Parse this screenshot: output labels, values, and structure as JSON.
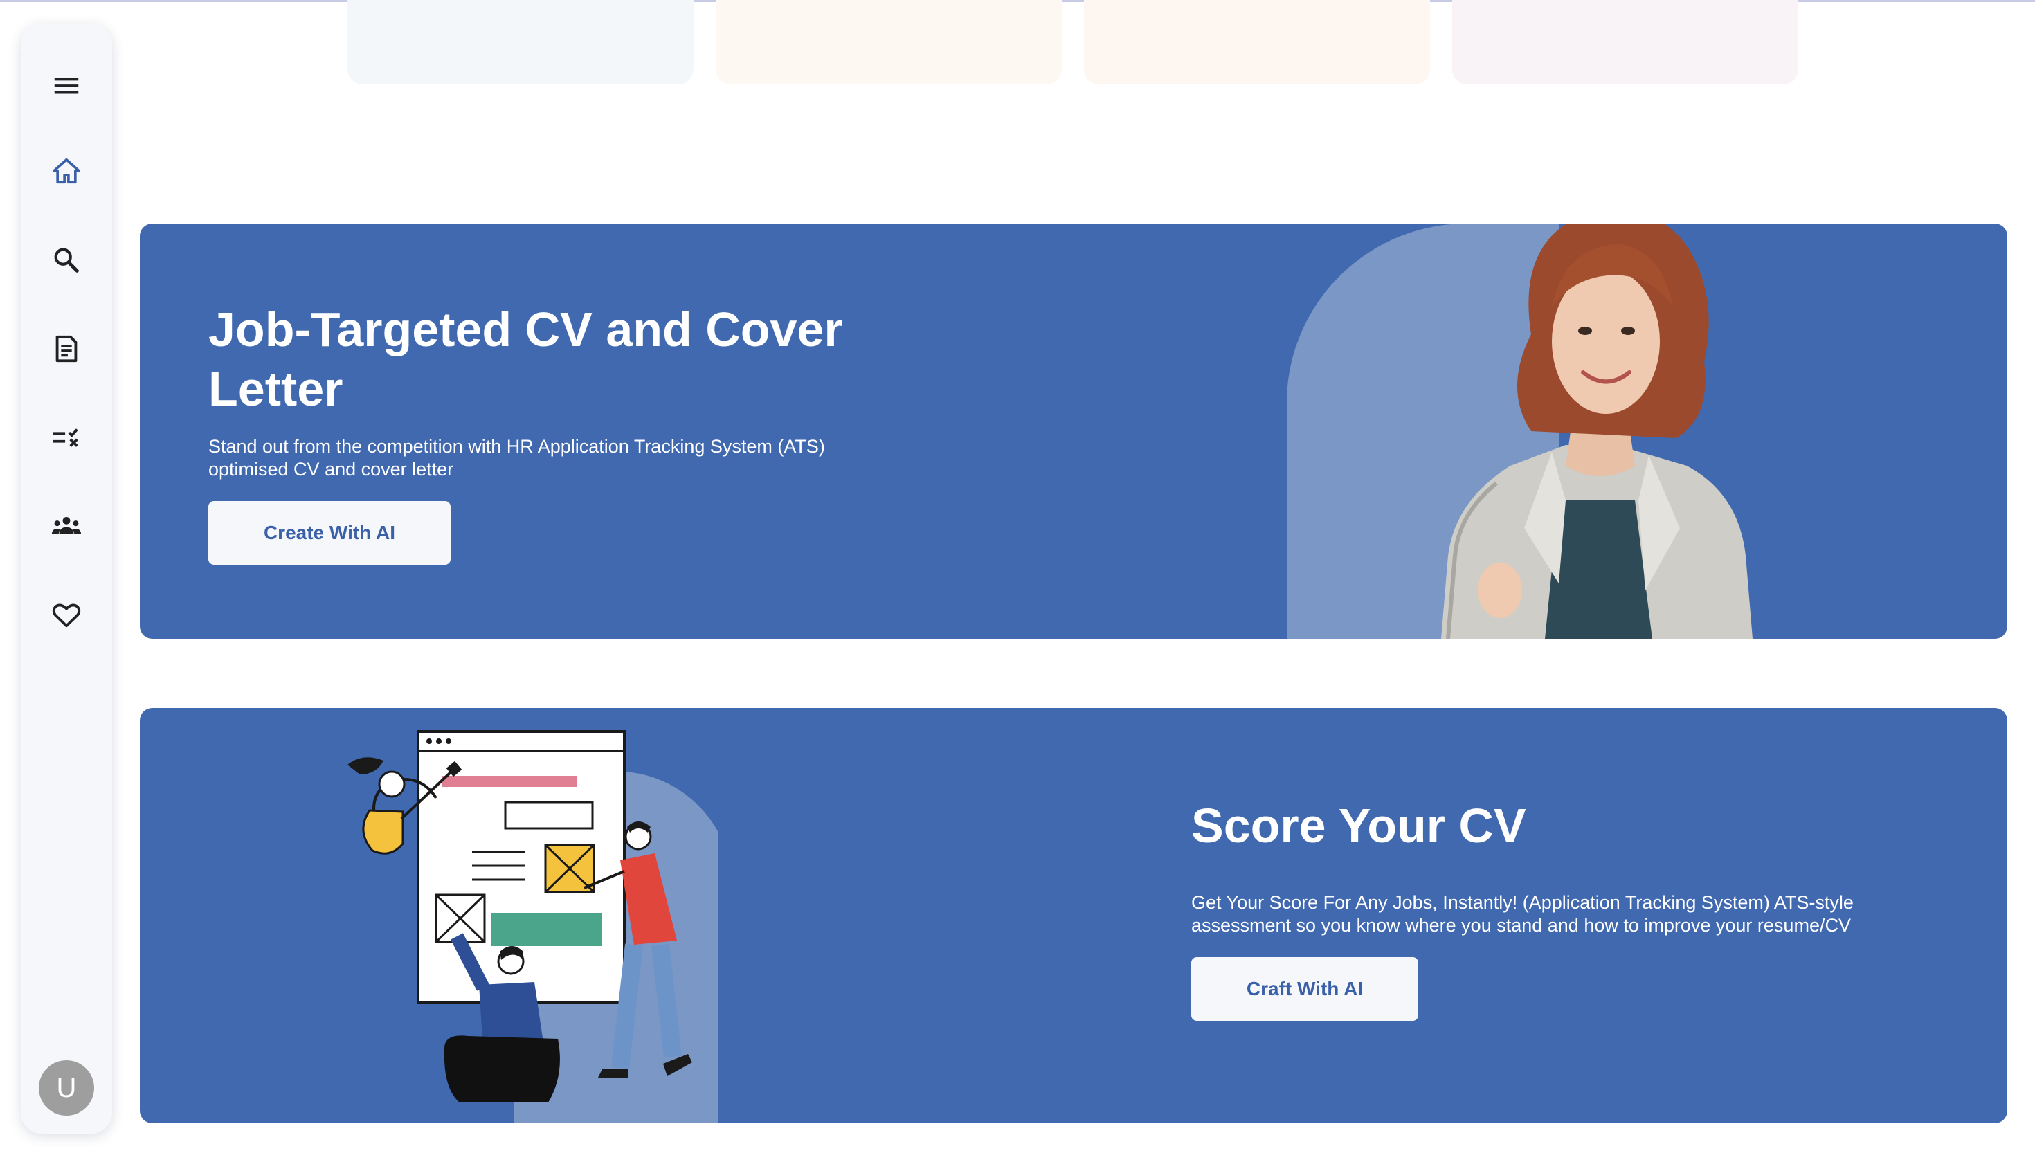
{
  "colors": {
    "banner_bg": "#4169b0",
    "arch": "#7a97c6",
    "button_bg": "#f6f7fb",
    "button_text": "#3a60a8",
    "sidebar_bg": "#f6f7fb",
    "active_icon": "#3a60a8",
    "icon": "#222222",
    "top_cards": [
      "#f4f7fa",
      "#fdf8f2",
      "#fef6f0",
      "#f9f2f6"
    ]
  },
  "sidebar": {
    "items": [
      {
        "icon": "menu-icon"
      },
      {
        "icon": "home-icon",
        "active": true
      },
      {
        "icon": "search-icon"
      },
      {
        "icon": "document-icon"
      },
      {
        "icon": "checklist-icon"
      },
      {
        "icon": "group-icon"
      },
      {
        "icon": "heart-icon"
      }
    ],
    "avatar_initial": "U"
  },
  "banner_cv": {
    "title": "Job-Targeted CV and Cover Letter",
    "description": "Stand out from the competition with HR Application Tracking System (ATS) optimised CV and cover letter",
    "button_label": "Create With AI",
    "image": "smiling-woman-in-blazer"
  },
  "banner_score": {
    "title": "Score Your CV",
    "description": "Get Your Score For Any Jobs, Instantly! (Application Tracking System) ATS-style assessment so you know where you stand and how to improve your resume/CV",
    "button_label": "Craft With AI",
    "image": "team-building-web-page-illustration"
  }
}
